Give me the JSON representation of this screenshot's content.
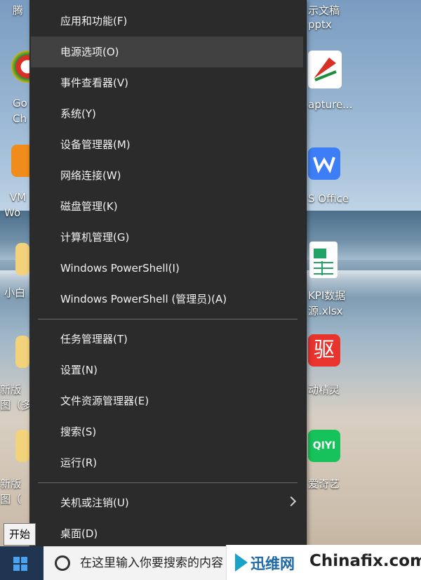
{
  "desktop": {
    "left_labels": [
      "腾",
      "Go",
      "Ch",
      "VM",
      "Wo",
      "小白",
      "新版",
      "图（多",
      "新版",
      "图（"
    ],
    "right_labels": [
      "示文稿",
      "pptx",
      "apture...",
      "S Office",
      "KPI数据",
      "源.xlsx",
      "动精灵",
      "爱奇艺"
    ],
    "right_icon_texts": [
      "驱",
      "QIYI"
    ]
  },
  "menu": {
    "items": [
      {
        "label": "应用和功能(F)"
      },
      {
        "label": "电源选项(O)"
      },
      {
        "label": "事件查看器(V)"
      },
      {
        "label": "系统(Y)"
      },
      {
        "label": "设备管理器(M)"
      },
      {
        "label": "网络连接(W)"
      },
      {
        "label": "磁盘管理(K)"
      },
      {
        "label": "计算机管理(G)"
      },
      {
        "label": "Windows PowerShell(I)"
      },
      {
        "label": "Windows PowerShell (管理员)(A)"
      },
      {
        "label": "任务管理器(T)"
      },
      {
        "label": "设置(N)"
      },
      {
        "label": "文件资源管理器(E)"
      },
      {
        "label": "搜索(S)"
      },
      {
        "label": "运行(R)"
      },
      {
        "label": "关机或注销(U)"
      },
      {
        "label": "桌面(D)"
      }
    ],
    "hovered_item": "电源选项(O)",
    "submenu_icon": "chevron-right-icon"
  },
  "tooltip": {
    "text": "开始"
  },
  "taskbar": {
    "search_placeholder": "在这里输入你要搜索的内容",
    "start_icon": "windows-logo-icon",
    "search_icon": "cortana-circle-icon"
  },
  "watermark": {
    "brand_cn": "迅维网",
    "brand_en": "Chinafix.com"
  },
  "colors": {
    "menu_bg": "#2b2b2b",
    "hover_bg": "#414141",
    "taskbar": "#1f3550",
    "accent": "#4aa3f0"
  }
}
